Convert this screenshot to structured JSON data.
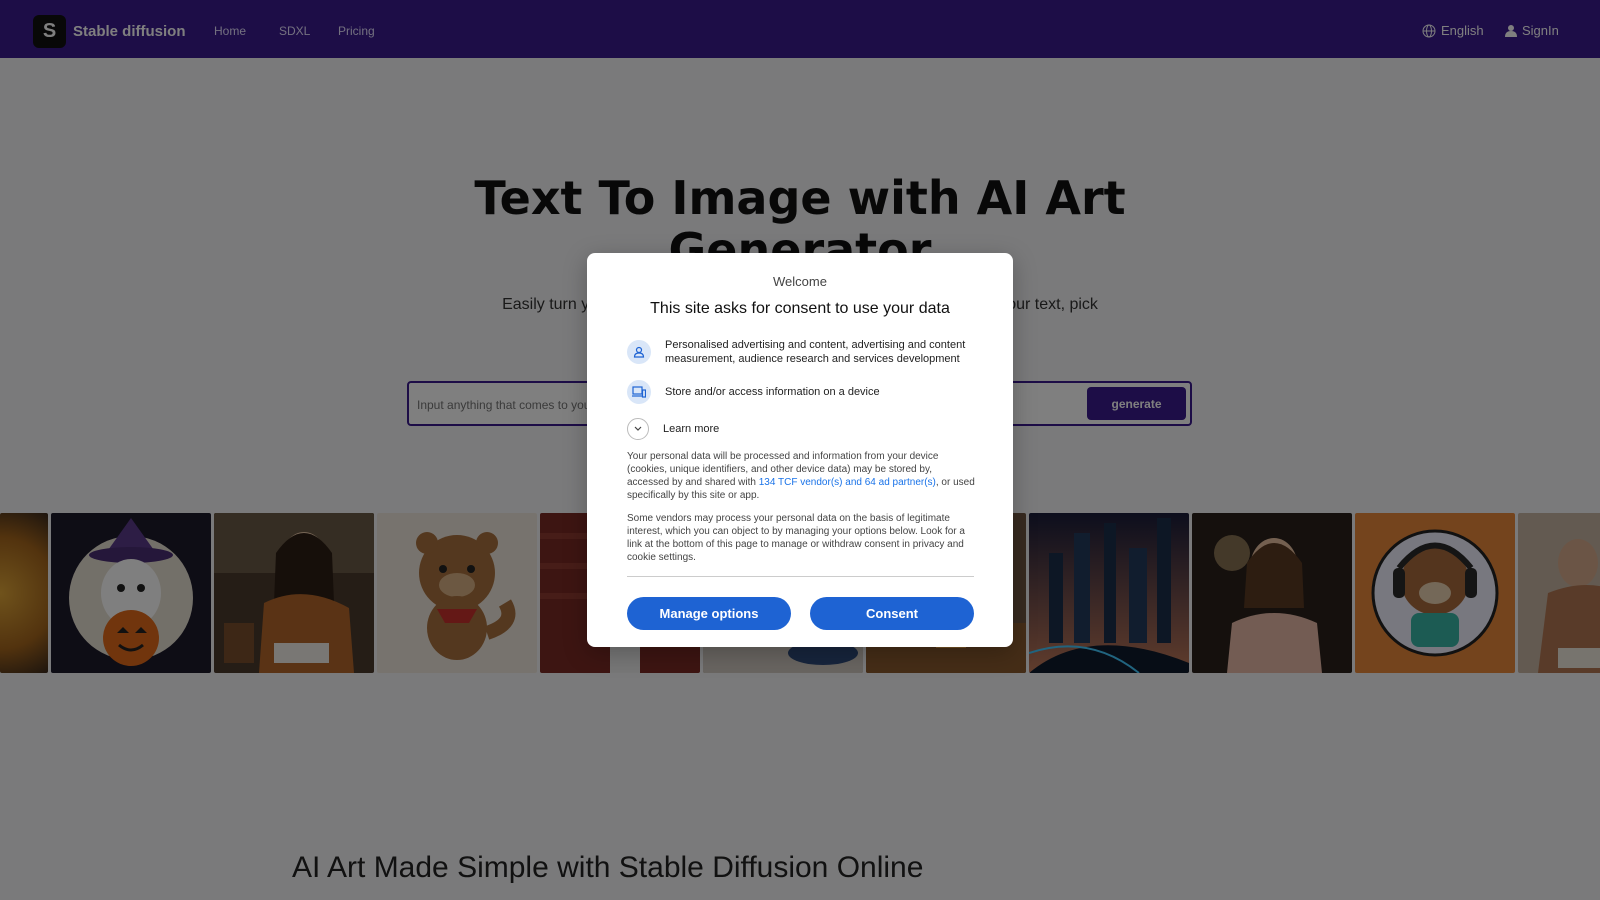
{
  "nav": {
    "brand": "Stable diffusion",
    "items": [
      "Home",
      "SDXL",
      "Pricing"
    ],
    "language": "English",
    "signin": "SignIn"
  },
  "hero": {
    "title": "Text To Image with AI Art Generator",
    "subtitle": "Easily turn your ideas into images with our AI art generator. Just enter your text, pick",
    "search_placeholder": "Input anything that comes to your mind",
    "generate_label": "generate"
  },
  "gallery": {
    "tiles": [
      "halloween-ghost",
      "woman-reading",
      "bear-cartoon",
      "red-scene",
      "blurred",
      "table",
      "futuristic-city",
      "woman-portrait",
      "bear-headphones",
      "woman-writing"
    ]
  },
  "section": {
    "heading": "AI Art Made Simple with Stable Diffusion Online"
  },
  "consent": {
    "welcome": "Welcome",
    "title": "This site asks for consent to use your data",
    "purpose1": "Personalised advertising and content, advertising and content measurement, audience research and services development",
    "purpose2": "Store and/or access information on a device",
    "learn_more": "Learn more",
    "para1_a": "Your personal data will be processed and information from your device (cookies, unique identifiers, and other device data) may be stored by, accessed by and shared with ",
    "para1_link": "134 TCF vendor(s) and 64 ad partner(s)",
    "para1_b": ", or used specifically by this site or app.",
    "para2": "Some vendors may process your personal data on the basis of legitimate interest, which you can object to by managing your options below. Look for a link at the bottom of this page to manage or withdraw consent in privacy and cookie settings.",
    "manage_label": "Manage options",
    "consent_label": "Consent"
  },
  "colors": {
    "nav_bg": "#3b1a8f",
    "primary_button": "#1e63d3",
    "generate_button": "#3b1a8f"
  }
}
